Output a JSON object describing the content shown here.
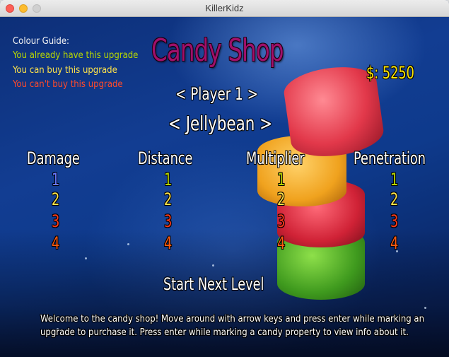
{
  "window": {
    "title": "KillerKidz"
  },
  "colour_guide": {
    "title": "Colour Guide:",
    "have": "You already have this upgrade",
    "can_buy": "You can buy this upgrade",
    "cant_buy": "You can't buy this upgrade",
    "colors": {
      "have": "#b8d800",
      "can_buy": "#ffe34a",
      "cant_buy": "#ff4a2a"
    }
  },
  "shop": {
    "title": "Candy Shop",
    "money": "$: 5250",
    "player_selector": "<  Player 1     >",
    "candy_selector": "<  Jellybean   >",
    "start_button": "Start Next Level",
    "welcome": "Welcome to the candy shop! Move around with arrow keys and press enter while marking an upgrade to purchase it. Press enter while marking a candy property to view info about it."
  },
  "upgrades": {
    "columns": [
      {
        "name": "Damage",
        "levels": [
          "1",
          "2",
          "3",
          "4"
        ]
      },
      {
        "name": "Distance",
        "levels": [
          "1",
          "2",
          "3",
          "4"
        ]
      },
      {
        "name": "Multiplier",
        "levels": [
          "1",
          "2",
          "3",
          "4"
        ]
      },
      {
        "name": "Penetration",
        "levels": [
          "1",
          "2",
          "3",
          "4"
        ]
      }
    ]
  }
}
